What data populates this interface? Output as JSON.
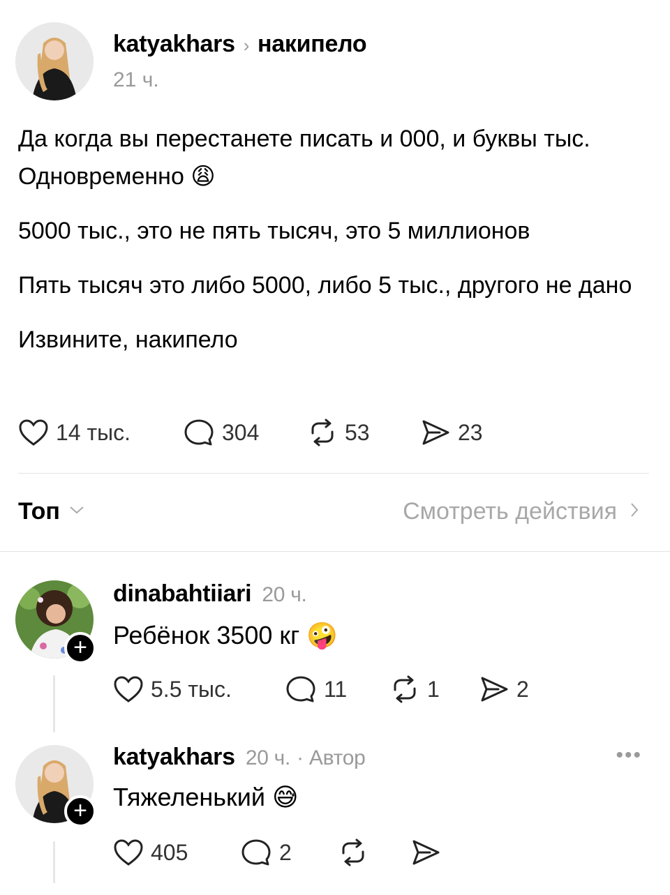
{
  "post": {
    "username": "katyakhars",
    "topic": "накипело",
    "time": "21 ч.",
    "paragraphs": [
      "Да когда вы перестанете писать и 000, и буквы тыс. Одновременно 😩",
      "5000 тыс., это не пять тысяч, это 5 миллионов",
      "Пять тысяч это либо 5000, либо 5 тыс., другого не дано",
      "Извините, накипело"
    ],
    "likes": "14 тыс.",
    "comments": "304",
    "reposts": "53",
    "shares": "23"
  },
  "sort": {
    "label": "Топ",
    "view_activity": "Смотреть действия"
  },
  "replies": [
    {
      "username": "dinabahtiiari",
      "time": "20 ч.",
      "author_tag": "",
      "text": "Ребёнок 3500 кг 🤪",
      "likes": "5.5 тыс.",
      "comments": "11",
      "reposts": "1",
      "shares": "2"
    },
    {
      "username": "katyakhars",
      "time": "20 ч.",
      "author_tag": "· Автор",
      "text": "Тяжеленький 😅",
      "likes": "405",
      "comments": "2",
      "reposts": "",
      "shares": ""
    }
  ],
  "icons": {
    "heart": "heart-icon",
    "comment": "comment-icon",
    "repost": "repost-icon",
    "share": "share-icon",
    "more": "more-icon",
    "chevron": "chevron-icon"
  }
}
